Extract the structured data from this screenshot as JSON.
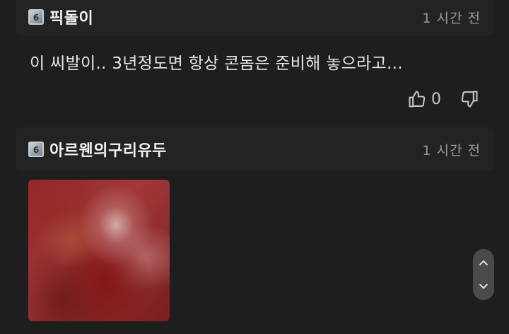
{
  "comments": [
    {
      "level": "6",
      "nickname": "픽돌이",
      "time": "1 시간 전",
      "text": "이 씨발이.. 3년정도면 항상 콘돔은 준비해 놓으라고...",
      "likes": "0"
    },
    {
      "level": "6",
      "nickname": "아르웬의구리유두",
      "time": "1 시간 전"
    }
  ],
  "icons": {
    "like": "thumbs-up-icon",
    "dislike": "thumbs-down-icon",
    "scroll_up": "chevron-up-icon",
    "scroll_down": "chevron-down-icon"
  },
  "colors": {
    "background": "#1e1e1e",
    "header_background": "#232323",
    "muted_text": "#9a9a9a"
  }
}
